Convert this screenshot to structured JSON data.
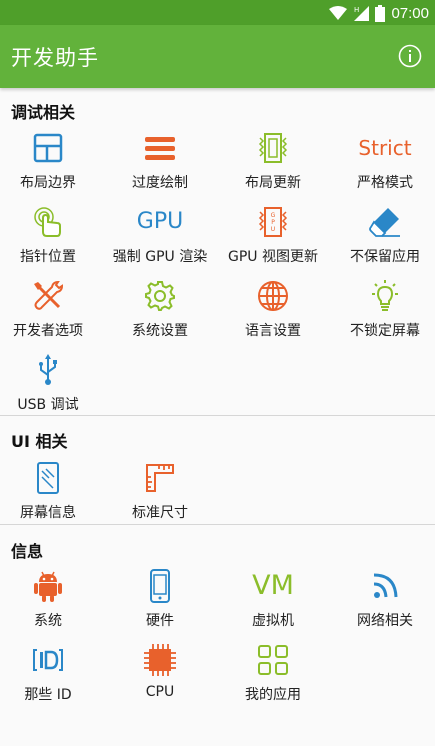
{
  "status": {
    "time": "07:00"
  },
  "appbar": {
    "title": "开发助手"
  },
  "sections": {
    "debug": {
      "title": "调试相关",
      "items": {
        "layout_bounds": "布局边界",
        "overdraw": "过度绘制",
        "layout_updates": "布局更新",
        "strict_mode": "严格模式",
        "pointer_location": "指针位置",
        "force_gpu": "强制 GPU 渲染",
        "gpu_view_updates": "GPU 视图更新",
        "dont_keep_activities": "不保留应用",
        "developer_options": "开发者选项",
        "system_settings": "系统设置",
        "language_settings": "语言设置",
        "stay_awake": "不锁定屏幕",
        "usb_debugging": "USB 调试"
      }
    },
    "ui": {
      "title": "UI 相关",
      "items": {
        "screen_info": "屏幕信息",
        "ruler": "标准尺寸"
      }
    },
    "info": {
      "title": "信息",
      "items": {
        "system": "系统",
        "hardware": "硬件",
        "vm": "虚拟机",
        "network": "网络相关",
        "ids": "那些 ID",
        "cpu": "CPU",
        "my_apps": "我的应用"
      }
    }
  },
  "icon_text": {
    "strict": "Strict",
    "gpu": "GPU",
    "vm": "VM"
  },
  "colors": {
    "accent_green": "#62b23b",
    "statusbar": "#4f9f2a",
    "blue": "#2a87c8",
    "orange": "#e8612c",
    "green": "#8bbd2a"
  }
}
